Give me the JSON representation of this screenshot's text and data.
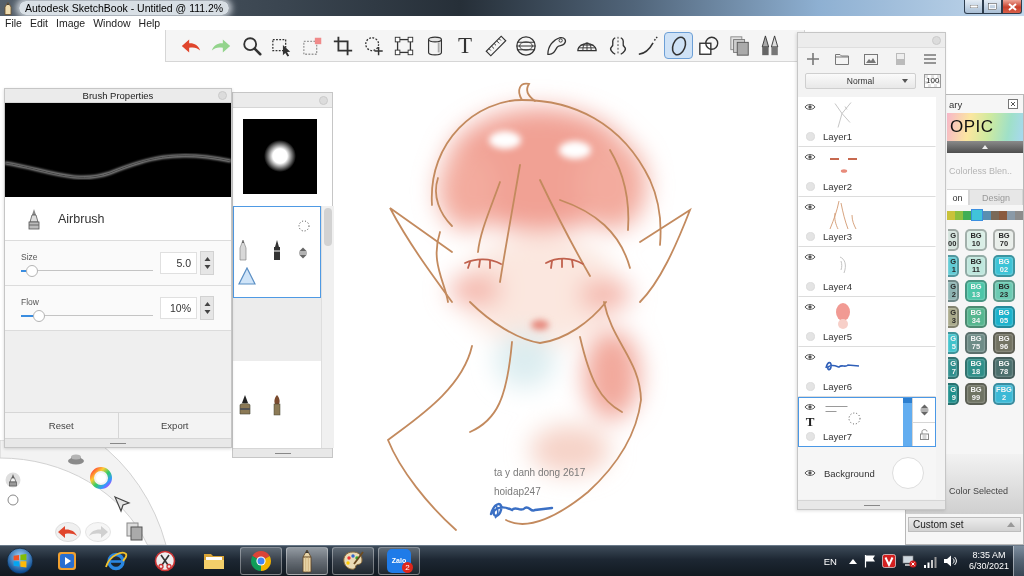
{
  "window": {
    "title": "Autodesk SketchBook - Untitled @ 111.2%"
  },
  "menu": [
    "File",
    "Edit",
    "Image",
    "Window",
    "Help"
  ],
  "toolbar": [
    {
      "kind": "undo",
      "selected": false
    },
    {
      "kind": "redo",
      "selected": false
    },
    {
      "kind": "zoom",
      "selected": false
    },
    {
      "kind": "select",
      "selected": false
    },
    {
      "kind": "deselect",
      "selected": false
    },
    {
      "kind": "crop",
      "selected": false
    },
    {
      "kind": "lasso",
      "selected": false
    },
    {
      "kind": "transform",
      "selected": false
    },
    {
      "kind": "fill",
      "selected": false
    },
    {
      "kind": "text",
      "label": "T",
      "selected": false
    },
    {
      "kind": "ruler",
      "selected": false
    },
    {
      "kind": "ellipse_guide",
      "selected": false
    },
    {
      "kind": "french_curve",
      "selected": false
    },
    {
      "kind": "perspective",
      "selected": false
    },
    {
      "kind": "symmetry",
      "selected": false
    },
    {
      "kind": "stroke",
      "selected": false
    },
    {
      "kind": "ellipse",
      "selected": true
    },
    {
      "kind": "shapes",
      "selected": false
    },
    {
      "kind": "copy",
      "selected": false
    },
    {
      "kind": "brushes",
      "selected": false
    }
  ],
  "brush_properties": {
    "title": "Brush Properties",
    "brush": "Airbrush",
    "sliders": [
      {
        "label": "Size",
        "value": "5.0",
        "level": 0.04
      },
      {
        "label": "Flow",
        "value": "10%",
        "level": 0.1
      }
    ],
    "buttons": [
      "Reset",
      "Export"
    ]
  },
  "brush_library": {
    "sets": [
      {
        "selected": true
      },
      {
        "selected": false
      }
    ]
  },
  "layers": {
    "blend_mode": "Normal",
    "opacity": "100",
    "items": [
      {
        "name": "Layer1",
        "kind": "paint",
        "visible": true,
        "selected": false
      },
      {
        "name": "Layer2",
        "kind": "paint",
        "visible": true,
        "selected": false
      },
      {
        "name": "Layer3",
        "kind": "paint",
        "visible": true,
        "selected": false
      },
      {
        "name": "Layer4",
        "kind": "paint",
        "visible": true,
        "selected": false
      },
      {
        "name": "Layer5",
        "kind": "paint",
        "visible": true,
        "selected": false
      },
      {
        "name": "Layer6",
        "kind": "paint",
        "visible": true,
        "selected": false
      },
      {
        "name": "Layer7",
        "kind": "text",
        "mark": "T",
        "visible": true,
        "selected": true,
        "level": 1
      },
      {
        "name": "Background",
        "kind": "background",
        "visible": true,
        "selected": false
      }
    ]
  },
  "copic_library": {
    "title": "ary",
    "logo": "OPIC",
    "color_name": "Colorless Blen..",
    "tabs": [
      {
        "label": "on",
        "selected": true
      },
      {
        "label": "Design",
        "selected": false
      }
    ],
    "swatches": [
      {
        "color": "#c9c23a",
        "selected": false
      },
      {
        "color": "#8cbf3f",
        "selected": false
      },
      {
        "color": "#3fae55",
        "selected": false
      },
      {
        "color": "#40c4d9",
        "selected": true
      },
      {
        "color": "#5a8fb0",
        "selected": false
      },
      {
        "color": "#7a6a58",
        "selected": false
      },
      {
        "color": "#8a5a3e",
        "selected": false
      },
      {
        "color": "#8a9aa8",
        "selected": false
      },
      {
        "color": "#8c8c8c",
        "selected": false
      }
    ],
    "markers": [
      {
        "lines": [
          "G",
          "00"
        ],
        "color": "#d4e3dc",
        "partial": true
      },
      {
        "lines": [
          "BG",
          "10"
        ],
        "color": "#d9eee6",
        "partial": false
      },
      {
        "lines": [
          "BG",
          "70"
        ],
        "color": "#e9eeea",
        "partial": false
      },
      {
        "lines": [
          "G",
          "1"
        ],
        "color": "#5fcad4",
        "partial": true
      },
      {
        "lines": [
          "BG",
          "11"
        ],
        "color": "#bfe7dd",
        "partial": false
      },
      {
        "lines": [
          "BG",
          "02"
        ],
        "color": "#3cc3d6",
        "partial": false
      },
      {
        "lines": [
          "G",
          "2"
        ],
        "color": "#8db3b2",
        "partial": true
      },
      {
        "lines": [
          "BG",
          "13"
        ],
        "color": "#4cc6a8",
        "partial": false
      },
      {
        "lines": [
          "BG",
          "23"
        ],
        "color": "#6ccab2",
        "partial": false
      },
      {
        "lines": [
          "G",
          "3"
        ],
        "color": "#a9a98a",
        "partial": true
      },
      {
        "lines": [
          "BG",
          "34"
        ],
        "color": "#56b68f",
        "partial": false
      },
      {
        "lines": [
          "BG",
          "05"
        ],
        "color": "#1ab2cc",
        "partial": false
      },
      {
        "lines": [
          "G",
          "5"
        ],
        "color": "#3fc3cc",
        "partial": true
      },
      {
        "lines": [
          "BG",
          "75"
        ],
        "color": "#6e8c87",
        "partial": false
      },
      {
        "lines": [
          "BG",
          "96"
        ],
        "color": "#727262",
        "partial": false
      },
      {
        "lines": [
          "G",
          "7"
        ],
        "color": "#2f8f8e",
        "partial": true
      },
      {
        "lines": [
          "BG",
          "18"
        ],
        "color": "#2f8f89",
        "partial": false
      },
      {
        "lines": [
          "BG",
          "78"
        ],
        "color": "#4b6f6d",
        "partial": false
      },
      {
        "lines": [
          "G",
          "9"
        ],
        "color": "#1e8f8c",
        "partial": true
      },
      {
        "lines": [
          "BG",
          "99"
        ],
        "color": "#6f7363",
        "partial": false
      },
      {
        "lines": [
          "FBG",
          "2"
        ],
        "color": "#3bb9d6",
        "partial": false
      }
    ],
    "status": "Color Selected",
    "set_name": "Custom set"
  },
  "canvas": {
    "texts": [
      "ta y danh dong 2617",
      "hoidap247"
    ]
  },
  "taskbar": {
    "apps": [
      {
        "kind": "media",
        "open": false,
        "selected": false
      },
      {
        "kind": "browser",
        "open": false,
        "selected": false
      },
      {
        "kind": "snipping",
        "open": false,
        "selected": false
      },
      {
        "kind": "folder",
        "open": false,
        "selected": false
      },
      {
        "kind": "chrome",
        "open": true,
        "selected": false
      },
      {
        "kind": "sketchbook",
        "open": true,
        "selected": true
      },
      {
        "kind": "paint",
        "open": true,
        "selected": false
      },
      {
        "kind": "chat",
        "open": true,
        "selected": false,
        "label": "Zalo",
        "badge": "2"
      }
    ],
    "language": "EN",
    "time": "8:35 AM",
    "date": "6/30/2021"
  }
}
